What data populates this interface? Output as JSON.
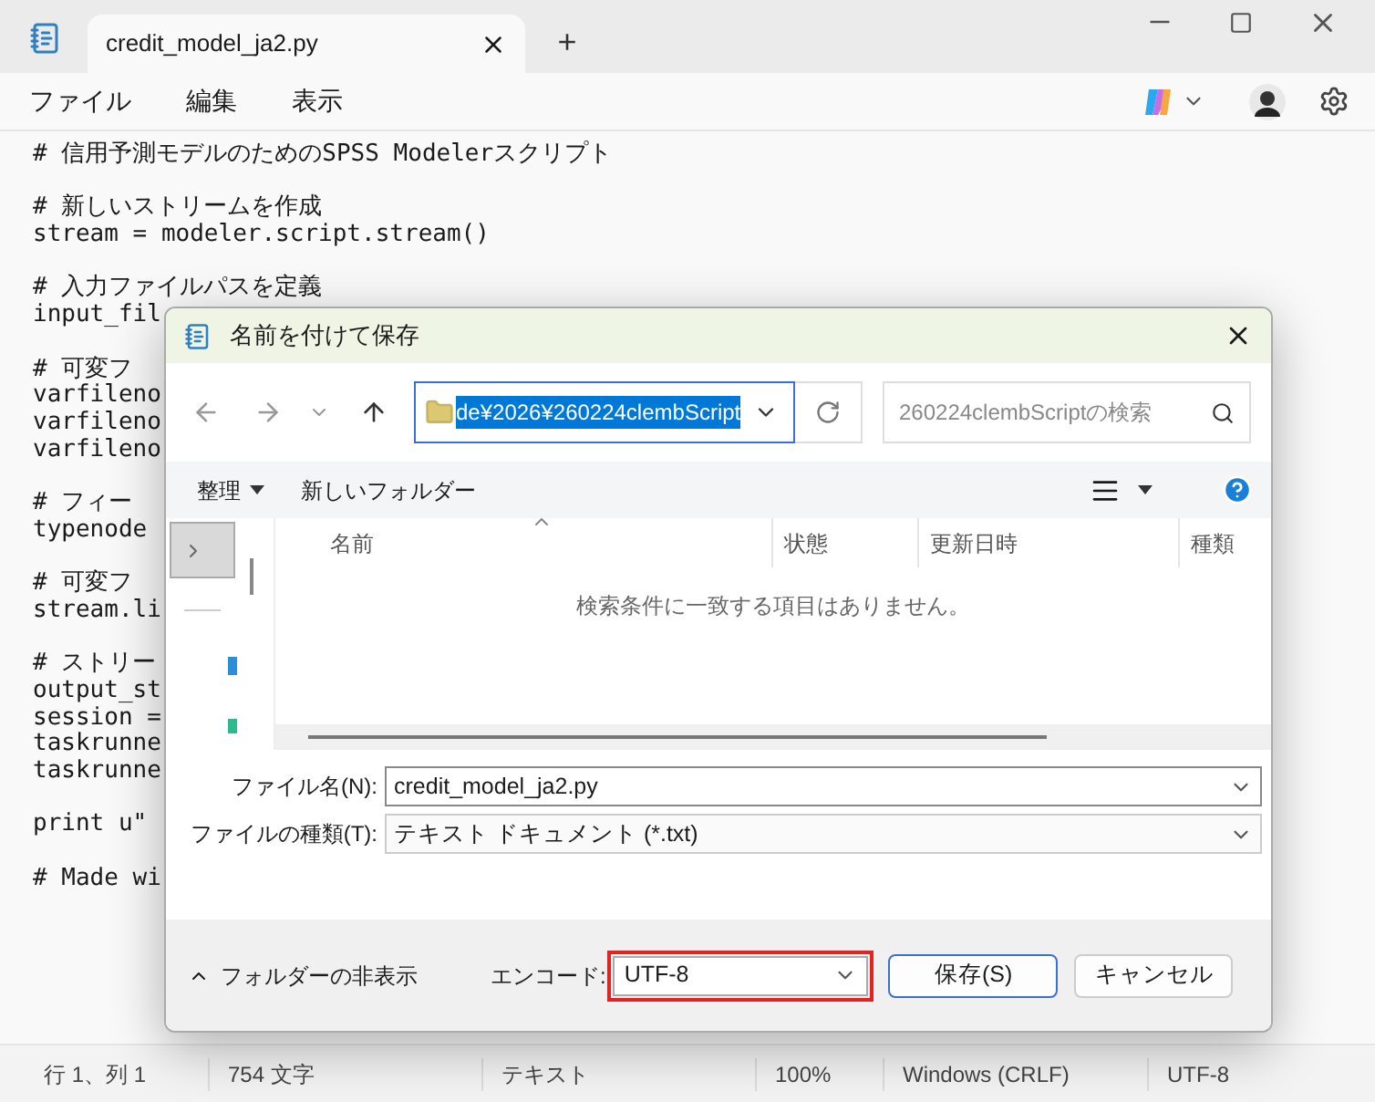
{
  "window": {
    "tab": {
      "title": "credit_model_ja2.py",
      "selected": true
    },
    "new_tab": "+"
  },
  "menu": [
    {
      "label": "ファイル"
    },
    {
      "label": "編集"
    },
    {
      "label": "表示"
    }
  ],
  "editor": {
    "blocks": [
      [
        "# 信用予測モデルのためのSPSS Modelerスクリプト"
      ],
      [
        "# 新しいストリームを作成",
        "stream = modeler.script.stream()"
      ],
      [
        "# 入力ファイルパスを定義",
        "input_fil"
      ],
      [
        "# 可変フ",
        "varfileno",
        "varfileno",
        "varfileno"
      ],
      [
        "# フィー",
        "typenode"
      ],
      [
        "# 可変フ",
        "stream.li"
      ],
      [
        "# ストリー",
        "output_st",
        "session =",
        "taskrunne",
        "taskrunne"
      ],
      [
        "print u\""
      ],
      [
        "# Made wi"
      ]
    ]
  },
  "dialog": {
    "title": "名前を付けて保存",
    "address": "de¥2026¥260224clembScript",
    "search": {
      "placeholder": "260224clembScriptの検索"
    },
    "toolbar": {
      "organize": "整理",
      "new_folder": "新しいフォルダー"
    },
    "columns": [
      "名前",
      "状態",
      "更新日時",
      "種類"
    ],
    "empty_message": "検索条件に一致する項目はありません。",
    "file_name": {
      "label": "ファイル名(N):",
      "value": "credit_model_ja2.py"
    },
    "file_type": {
      "label": "ファイルの種類(T):",
      "value": "テキスト ドキュメント (*.txt)"
    },
    "hide_folders": "フォルダーの非表示",
    "encoding": {
      "label": "エンコード:",
      "value": "UTF-8",
      "highlighted": true
    },
    "buttons": [
      {
        "label": "保存(S)",
        "kind": "primary"
      },
      {
        "label": "キャンセル",
        "kind": "secondary"
      }
    ]
  },
  "status_bar": [
    "行 1、列 1",
    "754 文字",
    "テキスト",
    "100%",
    "Windows (CRLF)",
    "UTF-8"
  ]
}
